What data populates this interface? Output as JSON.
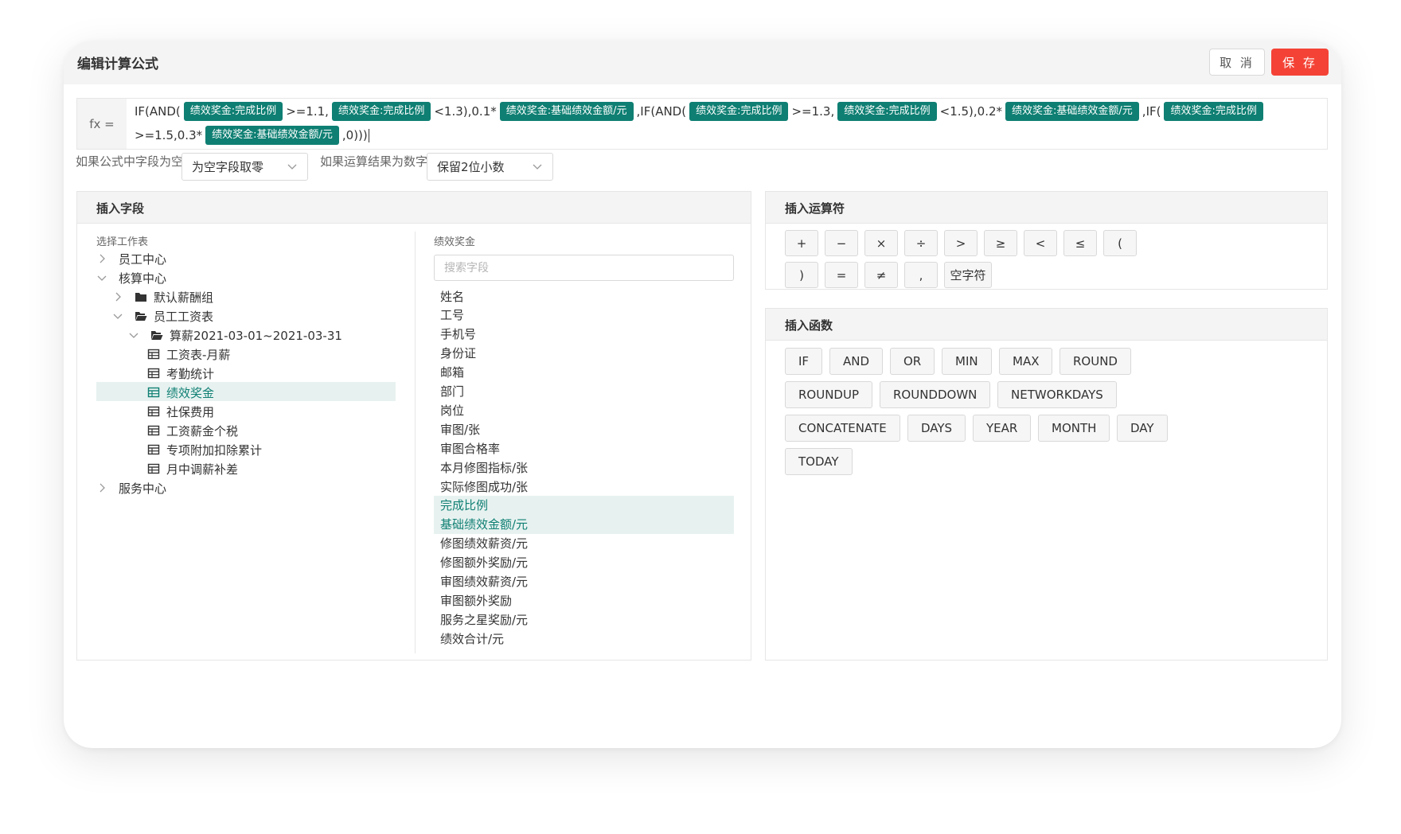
{
  "dialog": {
    "title": "编辑计算公式",
    "cancel_label": "取 消",
    "save_label": "保 存"
  },
  "formula": {
    "fx_label": "fx =",
    "line1": [
      {
        "t": "text",
        "v": "IF(AND("
      },
      {
        "t": "chip",
        "v": "绩效奖金:完成比例"
      },
      {
        "t": "text",
        "v": ">=1.1,"
      },
      {
        "t": "chip",
        "v": "绩效奖金:完成比例"
      },
      {
        "t": "text",
        "v": "<1.3),0.1*"
      },
      {
        "t": "chip",
        "v": "绩效奖金:基础绩效金额/元"
      },
      {
        "t": "text",
        "v": ",IF(AND("
      },
      {
        "t": "chip",
        "v": "绩效奖金:完成比例"
      },
      {
        "t": "text",
        "v": ">=1.3,"
      },
      {
        "t": "chip",
        "v": "绩效奖金:完成比例"
      },
      {
        "t": "text",
        "v": "<1.5),0.2*"
      },
      {
        "t": "chip",
        "v": "绩效奖金:基础绩效金额/元"
      },
      {
        "t": "text",
        "v": ",IF("
      },
      {
        "t": "chip",
        "v": "绩效奖金:完成比例"
      }
    ],
    "line2": [
      {
        "t": "text",
        "v": ">=1.5,0.3*"
      },
      {
        "t": "chip",
        "v": "绩效奖金:基础绩效金额/元"
      },
      {
        "t": "text",
        "v": ",0)))"
      }
    ]
  },
  "options": {
    "empty_label": "如果公式中字段为空",
    "empty_value": "为空字段取零",
    "number_label": "如果运算结果为数字",
    "number_value": "保留2位小数"
  },
  "insert_field": {
    "title": "插入字段",
    "sheet_label": "选择工作表",
    "field_group_label": "绩效奖金",
    "search_placeholder": "搜索字段",
    "tree": [
      {
        "label": "员工中心",
        "kind": "collapsed",
        "level": 0
      },
      {
        "label": "核算中心",
        "kind": "expanded",
        "level": 0
      },
      {
        "label": "默认薪酬组",
        "kind": "collapsed-folder",
        "level": 1
      },
      {
        "label": "员工工资表",
        "kind": "expanded-folder",
        "level": 1
      },
      {
        "label": "算薪2021-03-01~2021-03-31",
        "kind": "expanded-folder",
        "level": 2
      },
      {
        "label": "工资表-月薪",
        "kind": "table",
        "level": 3
      },
      {
        "label": "考勤统计",
        "kind": "table",
        "level": 3
      },
      {
        "label": "绩效奖金",
        "kind": "table",
        "level": 3,
        "selected": true
      },
      {
        "label": "社保费用",
        "kind": "table",
        "level": 3
      },
      {
        "label": "工资薪金个税",
        "kind": "table",
        "level": 3
      },
      {
        "label": "专项附加扣除累计",
        "kind": "table",
        "level": 3
      },
      {
        "label": "月中调薪补差",
        "kind": "table",
        "level": 3
      },
      {
        "label": "服务中心",
        "kind": "collapsed",
        "level": 0
      }
    ],
    "fields": [
      "姓名",
      "工号",
      "手机号",
      "身份证",
      "邮箱",
      "部门",
      "岗位",
      "审图/张",
      "审图合格率",
      "本月修图指标/张",
      "实际修图成功/张",
      "完成比例",
      "基础绩效金额/元",
      "修图绩效薪资/元",
      "修图额外奖励/元",
      "审图绩效薪资/元",
      "审图额外奖励",
      "服务之星奖励/元",
      "绩效合计/元"
    ],
    "selected_fields": [
      "完成比例",
      "基础绩效金额/元"
    ]
  },
  "insert_operator": {
    "title": "插入运算符",
    "ops": [
      "+",
      "−",
      "×",
      "÷",
      ">",
      "≥",
      "<",
      "≤",
      "(",
      ")",
      "=",
      "≠",
      ",",
      "空字符"
    ]
  },
  "insert_function": {
    "title": "插入函数",
    "funcs": [
      "IF",
      "AND",
      "OR",
      "MIN",
      "MAX",
      "ROUND",
      "ROUNDUP",
      "ROUNDDOWN",
      "NETWORKDAYS",
      "CONCATENATE",
      "DAYS",
      "YEAR",
      "MONTH",
      "DAY",
      "TODAY"
    ]
  },
  "colors": {
    "accent": "#0f7f73",
    "save": "#f44336",
    "selected_bg": "#e7f2f0"
  }
}
